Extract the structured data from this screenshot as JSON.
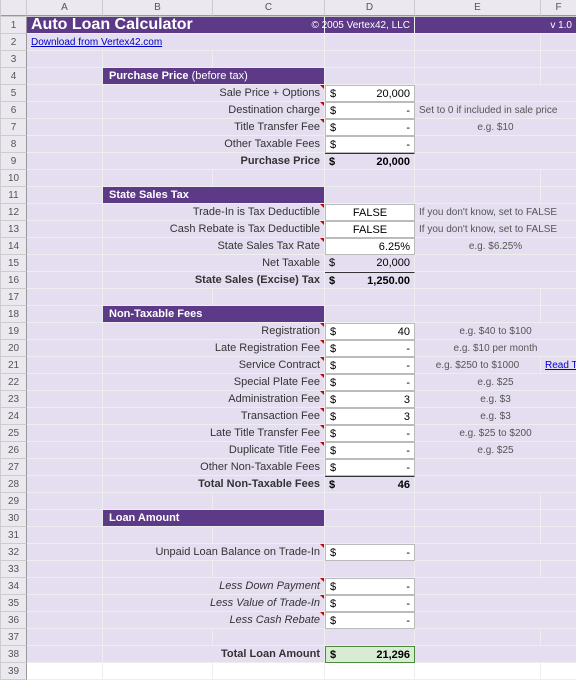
{
  "columns": [
    "A",
    "B",
    "C",
    "D",
    "E",
    "F"
  ],
  "rows": 39,
  "title": {
    "main": "Auto Loan Calculator",
    "copyright": "© 2005 Vertex42, LLC",
    "version": "v 1.0",
    "download": "Download from Vertex42.com"
  },
  "sections": {
    "purchase": {
      "header": "Purchase Price",
      "subheader": "(before tax)",
      "rows": [
        {
          "label": "Sale Price + Options",
          "sym": "$",
          "val": "20,000",
          "hint": ""
        },
        {
          "label": "Destination charge",
          "sym": "$",
          "val": "-",
          "hint": "Set to 0 if included in sale price"
        },
        {
          "label": "Title Transfer Fee",
          "sym": "$",
          "val": "-",
          "hint": "e.g. $10"
        },
        {
          "label": "Other Taxable Fees",
          "sym": "$",
          "val": "-",
          "hint": ""
        }
      ],
      "total": {
        "label": "Purchase Price",
        "sym": "$",
        "val": "20,000"
      }
    },
    "tax": {
      "header": "State Sales Tax",
      "rows": [
        {
          "label": "Trade-In is Tax Deductible",
          "val": "FALSE",
          "hint": "If you don't know, set to FALSE"
        },
        {
          "label": "Cash Rebate is Tax Deductible",
          "val": "FALSE",
          "hint": "If you don't know, set to FALSE"
        },
        {
          "label": "State Sales Tax Rate",
          "val": "6.25%",
          "hint": "e.g. $6.25%"
        }
      ],
      "net": {
        "label": "Net Taxable",
        "sym": "$",
        "val": "20,000"
      },
      "total": {
        "label": "State Sales (Excise) Tax",
        "sym": "$",
        "val": "1,250.00"
      }
    },
    "nontax": {
      "header": "Non-Taxable Fees",
      "rows": [
        {
          "label": "Registration",
          "sym": "$",
          "val": "40",
          "hint": "e.g. $40 to $100"
        },
        {
          "label": "Late Registration Fee",
          "sym": "$",
          "val": "-",
          "hint": "e.g. $10 per month"
        },
        {
          "label": "Service Contract",
          "sym": "$",
          "val": "-",
          "hint": "e.g. $250 to $1000",
          "link": "Read This"
        },
        {
          "label": "Special Plate Fee",
          "sym": "$",
          "val": "-",
          "hint": "e.g. $25"
        },
        {
          "label": "Administration Fee",
          "sym": "$",
          "val": "3",
          "hint": "e.g. $3"
        },
        {
          "label": "Transaction Fee",
          "sym": "$",
          "val": "3",
          "hint": "e.g. $3"
        },
        {
          "label": "Late Title Transfer Fee",
          "sym": "$",
          "val": "-",
          "hint": "e.g. $25 to $200"
        },
        {
          "label": "Duplicate Title Fee",
          "sym": "$",
          "val": "-",
          "hint": "e.g. $25"
        },
        {
          "label": "Other Non-Taxable Fees",
          "sym": "$",
          "val": "-",
          "hint": ""
        }
      ],
      "total": {
        "label": "Total Non-Taxable Fees",
        "sym": "$",
        "val": "46"
      }
    },
    "loan": {
      "header": "Loan Amount",
      "unpaid": {
        "label": "Unpaid Loan Balance on Trade-In",
        "sym": "$",
        "val": "-"
      },
      "less": [
        {
          "label": "Less Down Payment",
          "sym": "$",
          "val": "-"
        },
        {
          "label": "Less Value of Trade-In",
          "sym": "$",
          "val": "-"
        },
        {
          "label": "Less Cash Rebate",
          "sym": "$",
          "val": "-"
        }
      ],
      "total": {
        "label": "Total Loan Amount",
        "sym": "$",
        "val": "21,296"
      }
    }
  }
}
